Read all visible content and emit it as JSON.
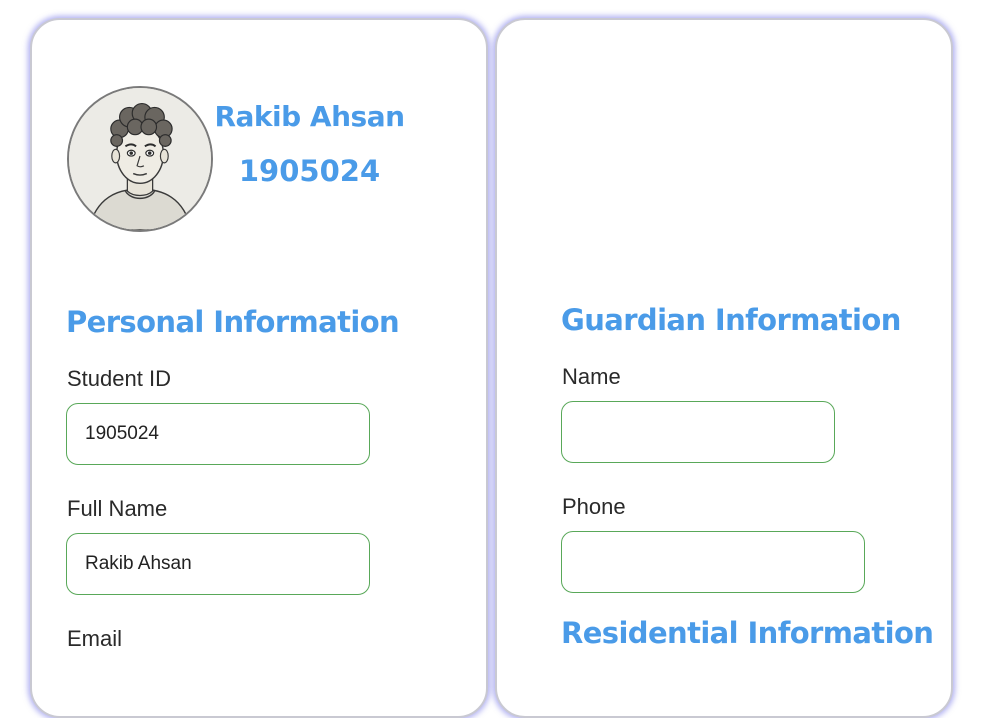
{
  "profile": {
    "name": "Rakib Ahsan",
    "student_id": "1905024"
  },
  "personal": {
    "title": "Personal Information",
    "student_id_label": "Student ID",
    "student_id_value": "1905024",
    "full_name_label": "Full Name",
    "full_name_value": "Rakib Ahsan",
    "email_label": "Email"
  },
  "guardian": {
    "title": "Guardian Information",
    "name_label": "Name",
    "name_value": "",
    "phone_label": "Phone",
    "phone_value": ""
  },
  "residential": {
    "title": "Residential Information"
  },
  "colors": {
    "accent": "#4a9be8",
    "input_border": "#59a859",
    "card_glow": "#6e6ee6"
  }
}
